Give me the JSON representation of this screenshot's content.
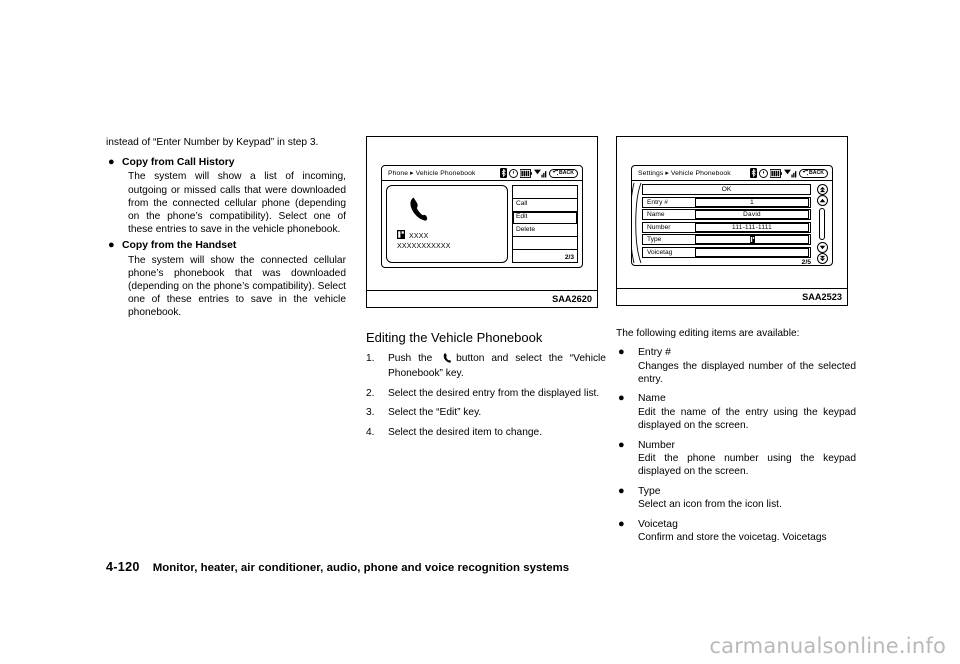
{
  "page": {
    "folio": "4-120",
    "footer_title": "Monitor, heater, air conditioner, audio, phone and voice recognition systems",
    "watermark": "carmanualsonline.info"
  },
  "left_column": {
    "intro": "instead of “Enter Number by Keypad” in step 3.",
    "bullets": [
      {
        "marker": "●",
        "heading": "Copy from Call History",
        "body": "The system will show a list of incoming, outgoing or missed calls that were downloaded from the connected cellular phone (depending on the phone’s compatibility). Select one of these entries to save in the vehicle phonebook."
      },
      {
        "marker": "●",
        "heading": "Copy from the Handset",
        "body": "The system will show the connected cellular phone’s phonebook that was downloaded (depending on the phone’s compatibility). Select one of these entries to save in the vehicle phonebook."
      }
    ]
  },
  "middle_column": {
    "figure": {
      "caption": "SAA2620",
      "screen": {
        "title": "Phone ▸ Vehicle Phonebook",
        "status_icons": [
          "bluetooth-icon",
          "clock-icon",
          "battery-icon",
          "signal-icon"
        ],
        "back_label": "BACK",
        "contact_card": {
          "handset_icon": "handset-icon",
          "type_icon": "contact-type-icon",
          "name_line1": "XXXX",
          "name_line2": "XXXXXXXXXXX"
        },
        "menu_items": [
          {
            "label": "",
            "selected": false
          },
          {
            "label": "Call",
            "selected": false
          },
          {
            "label": "Edit",
            "selected": true
          },
          {
            "label": "Delete",
            "selected": false
          },
          {
            "label": "",
            "selected": false
          },
          {
            "label": "",
            "selected": false
          }
        ],
        "page_indicator": "2/3"
      }
    },
    "section_heading": "Editing the Vehicle Phonebook",
    "steps": [
      {
        "num": "1.",
        "text_before": "Push the",
        "inline_icon": "phone-button-icon",
        "text_after": "button and select the “Vehicle Phonebook” key."
      },
      {
        "num": "2.",
        "text_before": "Select the desired entry from the displayed list.",
        "inline_icon": "",
        "text_after": ""
      },
      {
        "num": "3.",
        "text_before": "Select the “Edit” key.",
        "inline_icon": "",
        "text_after": ""
      },
      {
        "num": "4.",
        "text_before": "Select the desired item to change.",
        "inline_icon": "",
        "text_after": ""
      }
    ]
  },
  "right_column": {
    "figure": {
      "caption": "SAA2523",
      "screen": {
        "title": "Settings ▸ Vehicle Phonebook",
        "status_icons": [
          "bluetooth-icon",
          "clock-icon",
          "battery-icon",
          "signal-icon"
        ],
        "back_label": "BACK",
        "ok_label": "OK",
        "rows": [
          {
            "label": "Entry #",
            "value": "1"
          },
          {
            "label": "Name",
            "value": "David"
          },
          {
            "label": "Number",
            "value": "111-111-1111"
          },
          {
            "label": "Type",
            "value": ""
          },
          {
            "label": "Voicetag",
            "value": ""
          }
        ],
        "scroll_buttons": [
          "double-up-icon",
          "up-arrow-icon",
          "scroll-track",
          "down-arrow-icon",
          "double-down-icon"
        ],
        "page_indicator": "2/5"
      }
    },
    "intro": "The following editing items are available:",
    "items": [
      {
        "marker": "●",
        "label": "Entry #",
        "desc": "Changes the displayed number of the selected entry."
      },
      {
        "marker": "●",
        "label": "Name",
        "desc": "Edit the name of the entry using the keypad displayed on the screen."
      },
      {
        "marker": "●",
        "label": "Number",
        "desc": "Edit the phone number using the keypad displayed on the screen."
      },
      {
        "marker": "●",
        "label": "Type",
        "desc": "Select an icon from the icon list."
      },
      {
        "marker": "●",
        "label": "Voicetag",
        "desc": "Confirm and store the voicetag. Voicetags"
      }
    ]
  }
}
